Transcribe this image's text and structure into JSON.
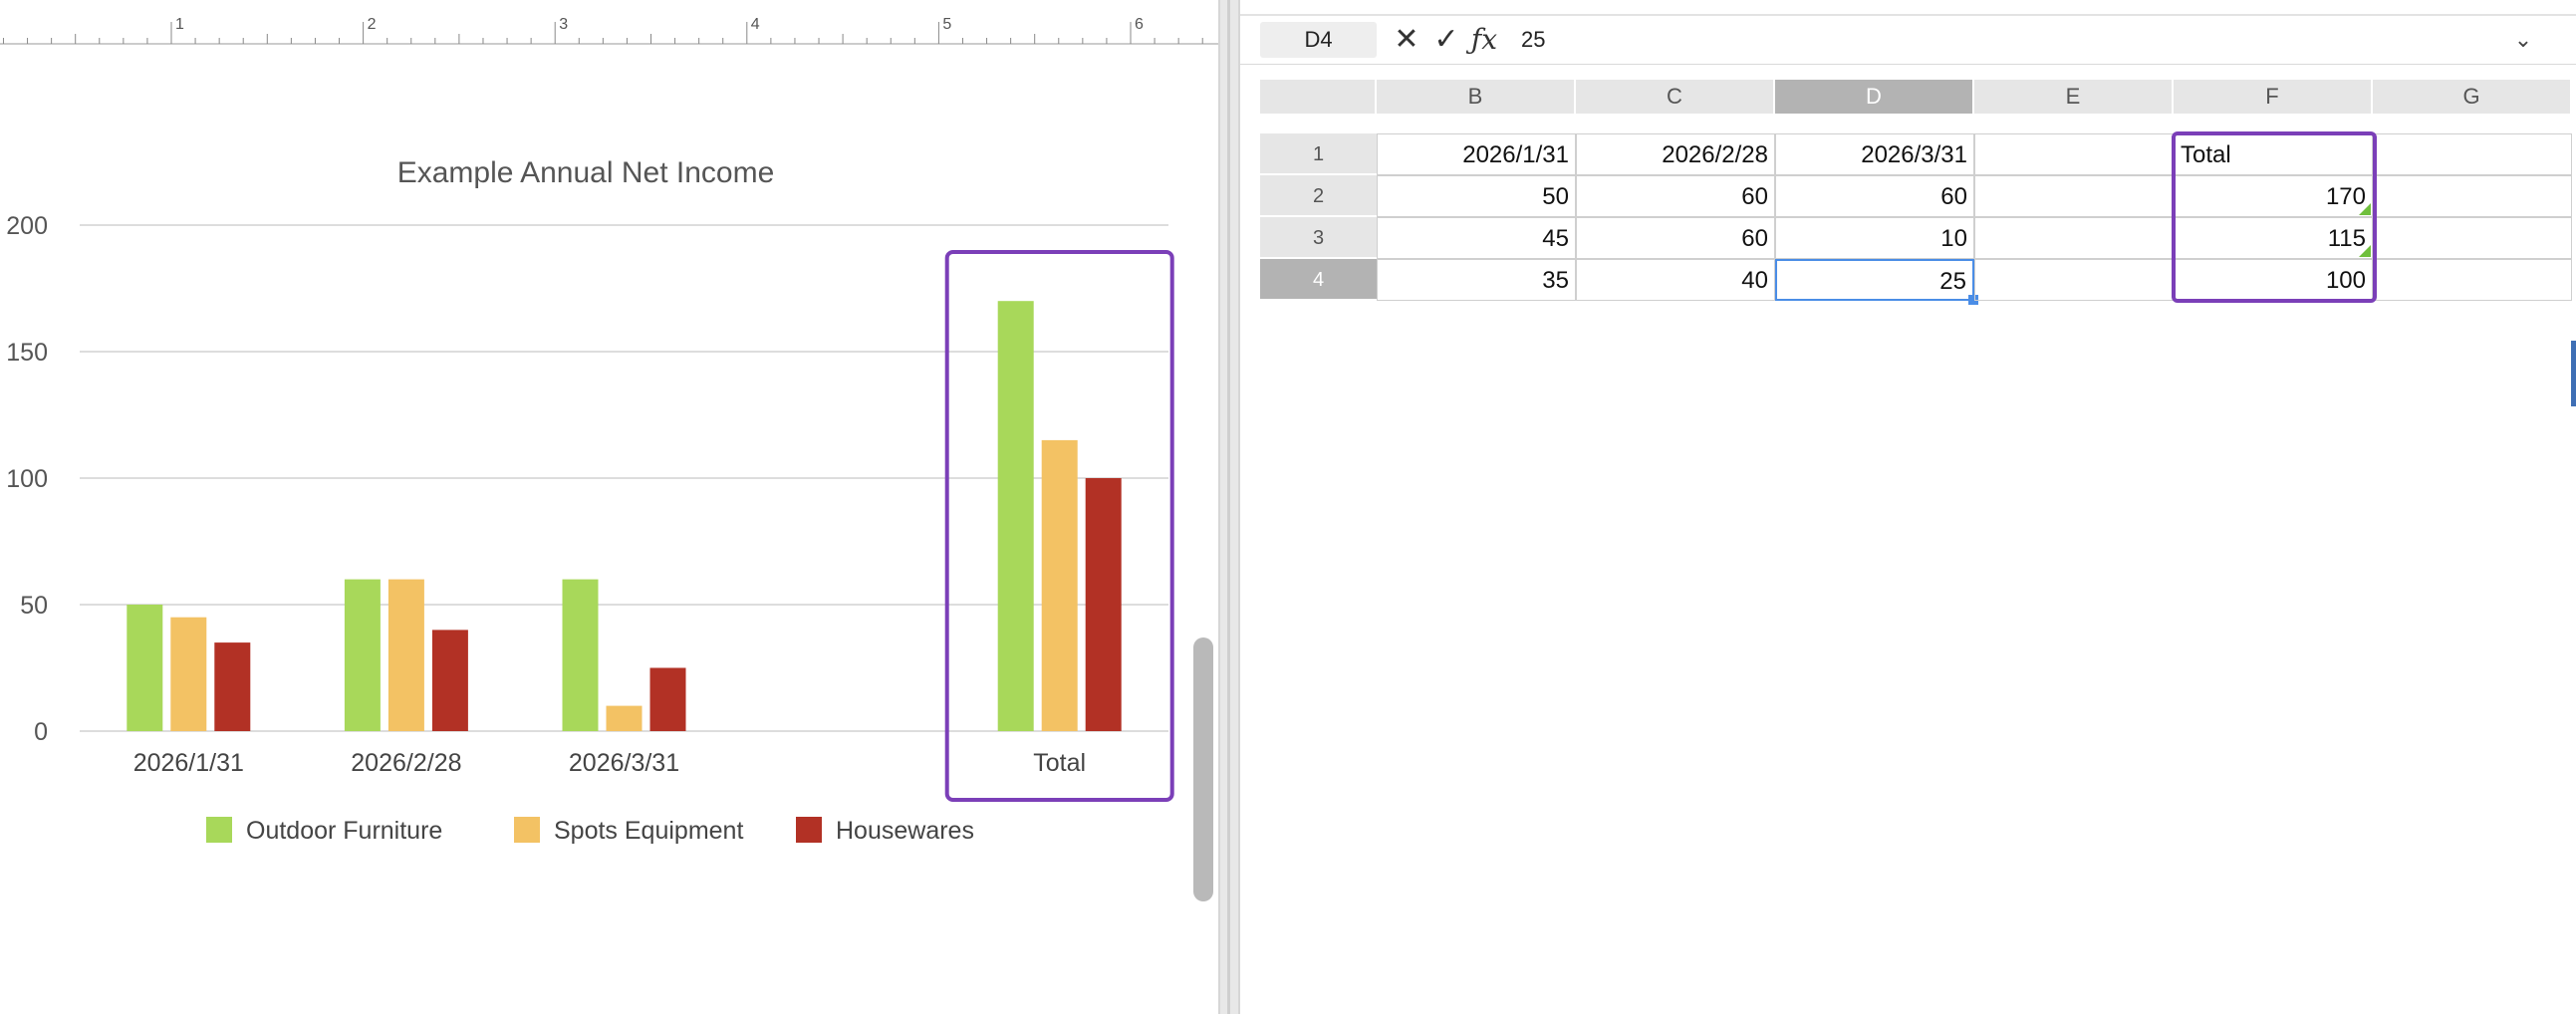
{
  "chart_data": {
    "type": "bar",
    "title": "Example Annual Net Income",
    "categories": [
      "2026/1/31",
      "2026/2/28",
      "2026/3/31",
      "",
      "Total"
    ],
    "series": [
      {
        "name": "Outdoor Furniture",
        "color": "#a8d85a",
        "values": [
          50,
          60,
          60,
          null,
          170
        ]
      },
      {
        "name": "Spots Equipment",
        "color": "#f3c264",
        "values": [
          45,
          60,
          10,
          null,
          115
        ]
      },
      {
        "name": "Housewares",
        "color": "#b23125",
        "values": [
          35,
          40,
          25,
          null,
          100
        ]
      }
    ],
    "ylim": [
      0,
      200
    ],
    "yticks": [
      0,
      50,
      100,
      150,
      200
    ],
    "grid": true,
    "legend": "bottom",
    "highlight_color": "#7b3fb8",
    "highlighted_category": "Total"
  },
  "ruler": {
    "labels": [
      "1",
      "2",
      "3",
      "4",
      "5",
      "6"
    ]
  },
  "spreadsheet": {
    "name_box": "D4",
    "formula": "25",
    "icons": {
      "cancel": "cancel-icon",
      "accept": "accept-icon",
      "function": "function-icon",
      "expand": "chevron-down-icon"
    },
    "columns": [
      "B",
      "C",
      "D",
      "E",
      "F",
      "G"
    ],
    "active_column": "D",
    "rows": [
      "1",
      "2",
      "3",
      "4"
    ],
    "active_row": "4",
    "cells": [
      [
        "2026/1/31",
        "2026/2/28",
        "2026/3/31",
        "",
        "Total",
        ""
      ],
      [
        "50",
        "60",
        "60",
        "",
        "170",
        ""
      ],
      [
        "45",
        "60",
        "10",
        "",
        "115",
        ""
      ],
      [
        "35",
        "40",
        "25",
        "",
        "100",
        ""
      ]
    ],
    "selected_cell": "D4",
    "highlight_color": "#7b3fb8",
    "selection_color": "#4a8de6"
  }
}
